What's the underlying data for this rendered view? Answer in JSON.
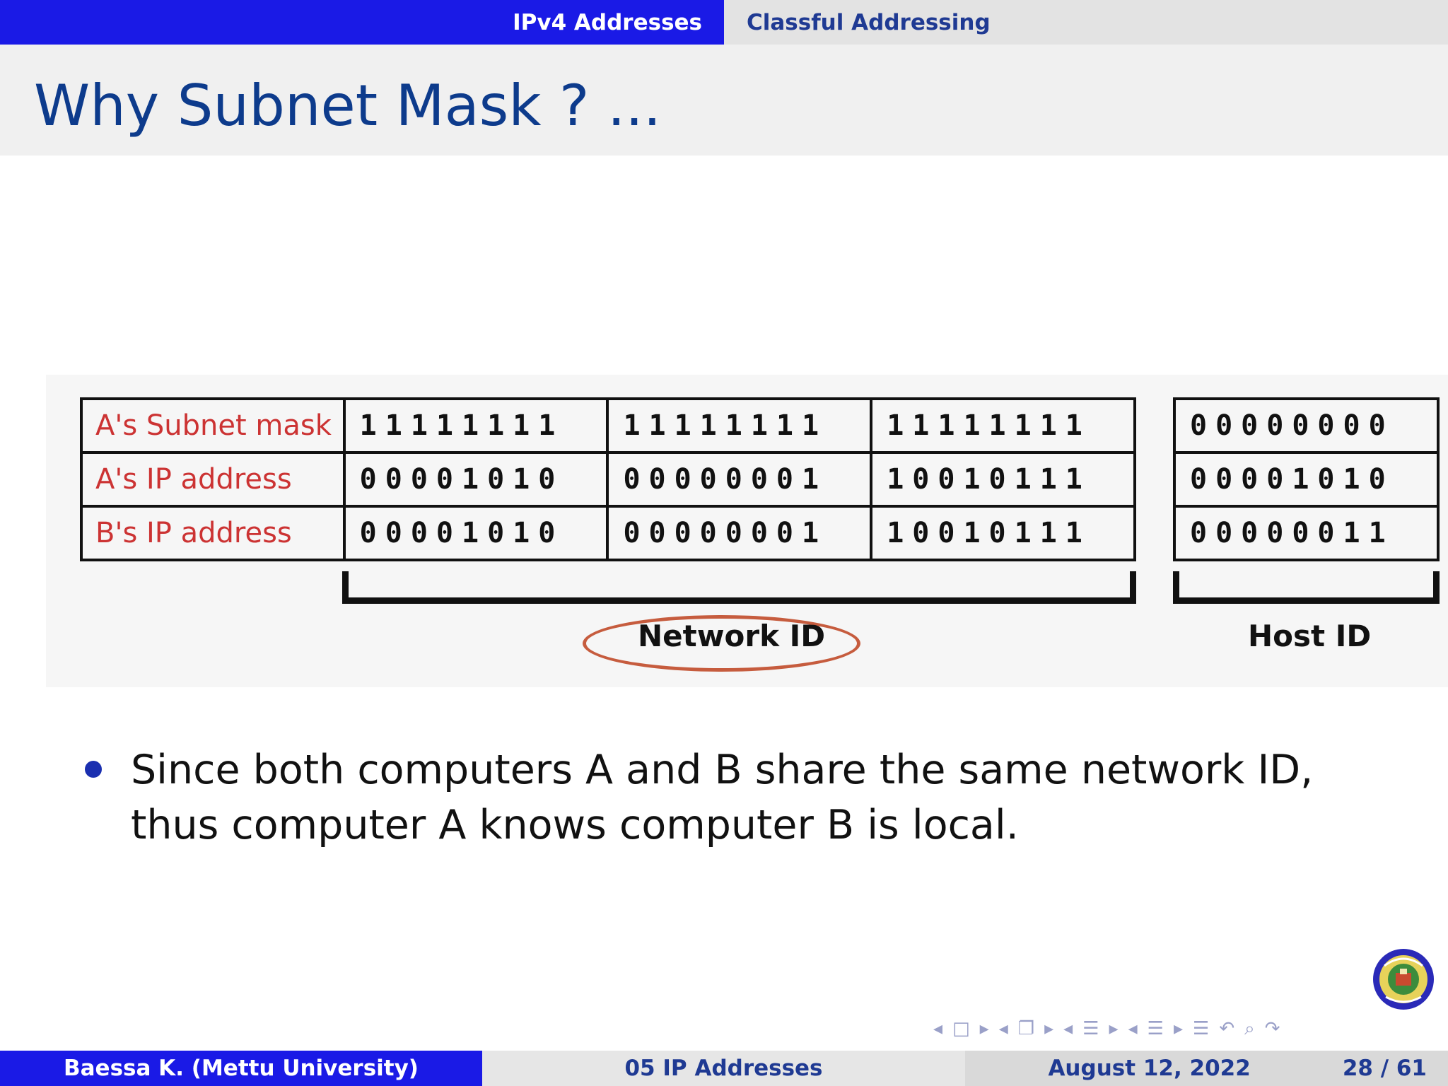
{
  "nav": {
    "active_section": "IPv4 Addresses",
    "subsection": "Classful Addressing"
  },
  "frame": {
    "title": "Why Subnet Mask ? ..."
  },
  "figure": {
    "rows": [
      {
        "label": "A's Subnet mask",
        "octets": [
          "11111111",
          "11111111",
          "11111111",
          "00000000"
        ]
      },
      {
        "label": "A's IP address",
        "octets": [
          "00001010",
          "00000001",
          "10010111",
          "00001010"
        ]
      },
      {
        "label": "B's IP address",
        "octets": [
          "00001010",
          "00000001",
          "10010111",
          "00000011"
        ]
      }
    ],
    "network_label": "Network ID",
    "host_label": "Host ID"
  },
  "bullets": [
    "Since both computers A and B share the same network ID, thus computer A knows computer B is local."
  ],
  "footer": {
    "author": "Baessa K.  (Mettu University)",
    "lecture": "05  IP Addresses",
    "date": "August 12, 2022",
    "page": "28 / 61"
  },
  "logo_icon": "mettu-university-seal-icon",
  "colors": {
    "accent_blue": "#1a1ae6",
    "title_blue": "#0d3b8c",
    "label_red": "#cc3333",
    "ellipse_orange": "#c65c3e"
  }
}
